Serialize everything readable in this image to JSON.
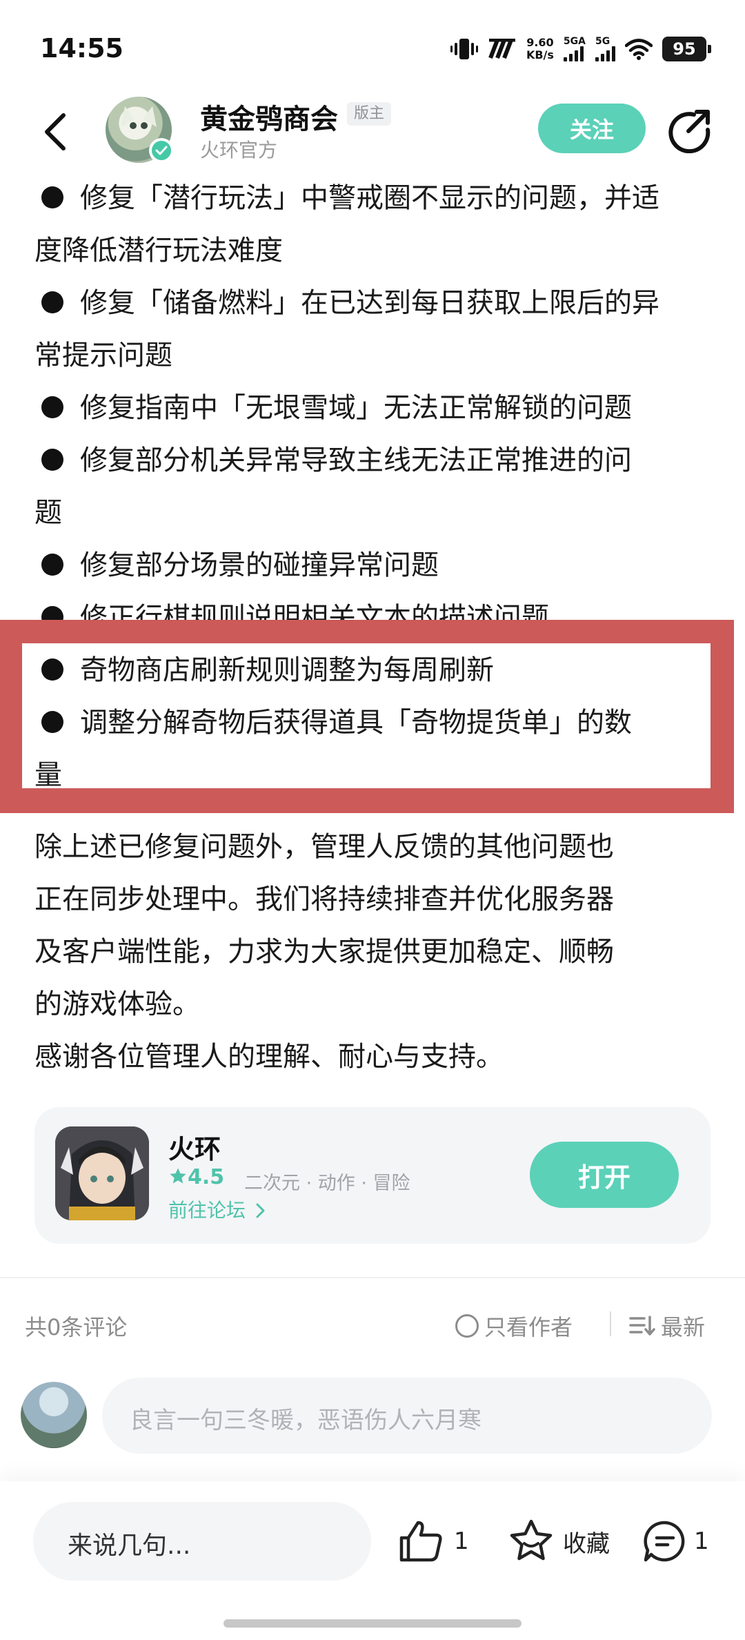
{
  "status_bar": {
    "time": "14:55",
    "net_speed_value": "9.60",
    "net_speed_unit": "KB/s",
    "signal1_label": "5GA",
    "signal2_label": "5G",
    "battery": "95"
  },
  "header": {
    "author_name": "黄金鸮商会",
    "role_badge": "版主",
    "author_sub": "火环官方",
    "follow_label": "关注"
  },
  "article": {
    "lines": [
      "修复「潜行玩法」中警戒圈不显示的问题，并适",
      "度降低潜行玩法难度",
      "修复「储备燃料」在已达到每日获取上限后的异",
      "常提示问题",
      "修复指南中「无垠雪域」无法正常解锁的问题",
      "修复部分机关异常导致主线无法正常推进的问",
      "题",
      "修复部分场景的碰撞异常问题",
      "修正行棋规则说明相关文本的描述问题"
    ],
    "highlighted": [
      "奇物商店刷新规则调整为每周刷新",
      "调整分解奇物后获得道具「奇物提货单」的数",
      "量"
    ],
    "paragraph": [
      "除上述已修复问题外，管理人反馈的其他问题也",
      "正在同步处理中。我们将持续排查并优化服务器",
      "及客户端性能，力求为大家提供更加稳定、顺畅",
      "的游戏体验。",
      "感谢各位管理人的理解、耐心与支持。"
    ]
  },
  "app_card": {
    "name": "火环",
    "rating": "4.5",
    "tags": "二次元 · 动作 · 冒险",
    "forum_link": "前往论坛",
    "open_label": "打开"
  },
  "comments": {
    "count_label": "共0条评论",
    "author_only_label": "只看作者",
    "sort_label": "最新",
    "input_placeholder": "良言一句三冬暖，恶语伤人六月寒"
  },
  "bottom_bar": {
    "say_placeholder": "来说几句...",
    "like_count": "1",
    "favorite_label": "收藏",
    "comment_count": "1"
  },
  "colors": {
    "accent": "#5bd1b8",
    "highlight_border": "#cc5a59"
  }
}
